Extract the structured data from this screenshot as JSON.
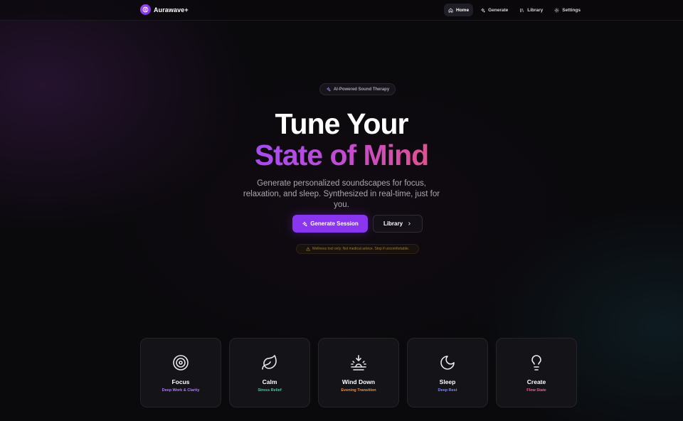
{
  "brand": {
    "name": "Aurawave+",
    "logo_icon": "waveform-circle-icon"
  },
  "nav": {
    "items": [
      {
        "label": "Home",
        "icon": "home-icon",
        "active": true
      },
      {
        "label": "Generate",
        "icon": "sparkles-icon",
        "active": false
      },
      {
        "label": "Library",
        "icon": "library-icon",
        "active": false
      },
      {
        "label": "Settings",
        "icon": "gear-icon",
        "active": false
      }
    ]
  },
  "hero": {
    "badge": "AI-Powered Sound Therapy",
    "title_line1": "Tune Your",
    "title_line2": "State of Mind",
    "subtitle": "Generate personalized soundscapes for focus, relaxation, and sleep. Synthesized in real-time, just for you.",
    "primary_button": "Generate Session",
    "secondary_button": "Library",
    "warning": "Wellness tool only. Not medical advice. Stop if uncomfortable."
  },
  "modes": [
    {
      "name": "Focus",
      "sub": "Deep Work & Clarity",
      "icon": "target-icon",
      "color": "#b07cf7"
    },
    {
      "name": "Calm",
      "sub": "Stress Relief",
      "icon": "leaf-icon",
      "color": "#3ed29a"
    },
    {
      "name": "Wind Down",
      "sub": "Evening Transition",
      "icon": "sunset-icon",
      "color": "#f0903c"
    },
    {
      "name": "Sleep",
      "sub": "Deep Rest",
      "icon": "moon-icon",
      "color": "#7f8cf5"
    },
    {
      "name": "Create",
      "sub": "Flow State",
      "icon": "lightbulb-icon",
      "color": "#ec5f9b"
    }
  ],
  "colors": {
    "accent": "#8a35ef",
    "background": "#0a090c"
  }
}
